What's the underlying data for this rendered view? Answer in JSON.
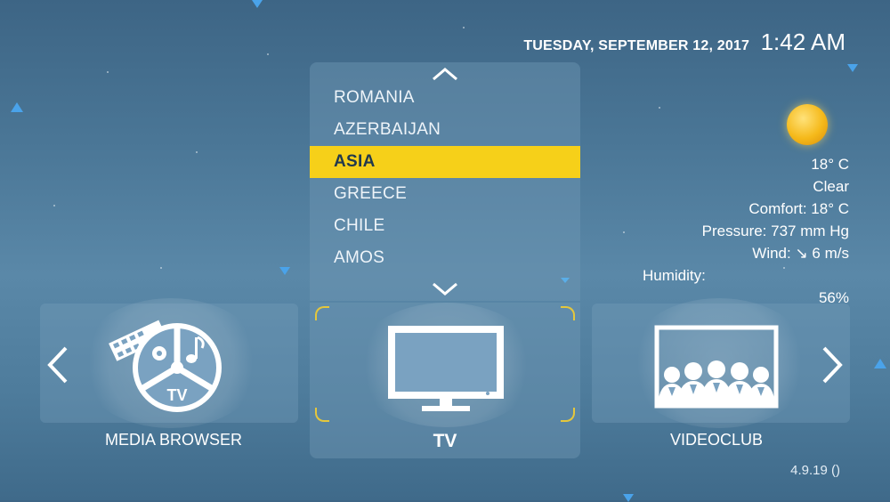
{
  "datetime": {
    "date": "TUESDAY, SEPTEMBER 12, 2017",
    "time": "1:42 AM"
  },
  "dropdown": {
    "items": [
      "ROMANIA",
      "AZERBAIJAN",
      "ASIA",
      "GREECE",
      "CHILE",
      "AMOS"
    ],
    "selected_index": 2,
    "up_icon": "chevron-up-icon",
    "down_icon": "chevron-down-icon"
  },
  "weather": {
    "icon": "sun-icon",
    "temperature": "18° C",
    "condition": "Clear",
    "comfort": "Comfort: 18° C",
    "pressure": "Pressure: 737 mm Hg",
    "wind": "Wind: ↘ 6 m/s",
    "humidity_label": "Humidity:",
    "humidity_value": "56%"
  },
  "tiles": {
    "left": {
      "label": "MEDIA BROWSER",
      "icon": "media-browser-icon",
      "icon_text": "TV"
    },
    "center": {
      "label": "TV",
      "icon": "tv-icon"
    },
    "right": {
      "label": "VIDEOCLUB",
      "icon": "videoclub-icon"
    }
  },
  "nav": {
    "prev_icon": "chevron-left-icon",
    "next_icon": "chevron-right-icon"
  },
  "version": "4.9.19 ()",
  "colors": {
    "highlight": "#f6d019",
    "accent_triangles": "#4aa3ea",
    "focus_corners": "#e5c73c"
  }
}
